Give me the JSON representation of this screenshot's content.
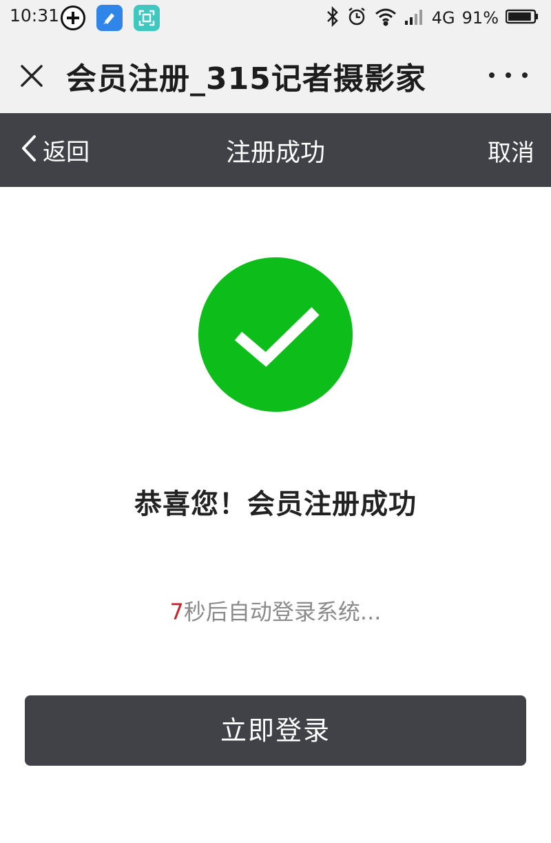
{
  "status_bar": {
    "time": "10:31",
    "network": "4G",
    "battery": "91%",
    "battery_level": 0.91
  },
  "title_bar": {
    "title": "会员注册_315记者摄影家"
  },
  "nav_bar": {
    "back_label": "返回",
    "title": "注册成功",
    "cancel_label": "取消"
  },
  "content": {
    "success_message": "恭喜您！会员注册成功",
    "countdown_seconds": "7",
    "countdown_text": "秒后自动登录系统...",
    "login_button_label": "立即登录"
  },
  "colors": {
    "nav_background": "#404247",
    "success_green": "#0dbe1a",
    "countdown_number": "#c0272d"
  },
  "icons": [
    "close-icon",
    "more-icon",
    "back-chevron-icon",
    "checkmark-icon",
    "bluetooth-icon",
    "alarm-icon",
    "wifi-icon",
    "signal-icon",
    "battery-icon"
  ]
}
